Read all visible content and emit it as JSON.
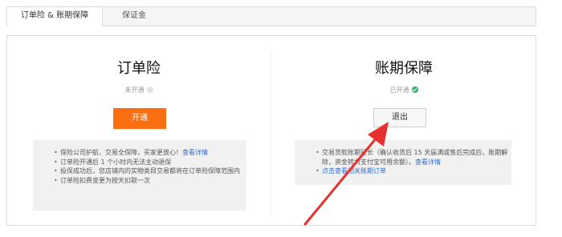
{
  "tabs": [
    {
      "label": "订单险 & 账期保障",
      "active": true
    },
    {
      "label": "保证金",
      "active": false
    }
  ],
  "left_card": {
    "title": "订单险",
    "status": "未开通",
    "button": "开通",
    "bullets": [
      {
        "text": "保险公司护航，交易全保障，买家更放心！",
        "link": "查看详情"
      },
      {
        "text": "订单险开通后 1 个小时内无法主动退保",
        "link": ""
      },
      {
        "text": "投保成功后，您店铺内的实物类目交易都将在订单险保障范围内",
        "link": ""
      },
      {
        "text": "订单险扣费变更为按天扣取一次",
        "link": ""
      }
    ]
  },
  "right_card": {
    "title": "账期保障",
    "status": "已开通",
    "button": "退出",
    "bullets": [
      {
        "text": "交易货款账期延长（确认收货后 15 天届满或售后完成后，账期解除，资金转为支付宝可用余额）。",
        "link": "查看详情"
      },
      {
        "text": "",
        "link": "点击查看相关账期订单"
      }
    ]
  },
  "colors": {
    "primary_button": "#f96f11",
    "link": "#2d6ecf",
    "success": "#2db36b",
    "annotation_arrow": "#e8312f"
  },
  "icons": {
    "status_off": "gray-dot-icon",
    "status_on": "check-circle-icon",
    "annotation": "red-arrow-icon"
  }
}
